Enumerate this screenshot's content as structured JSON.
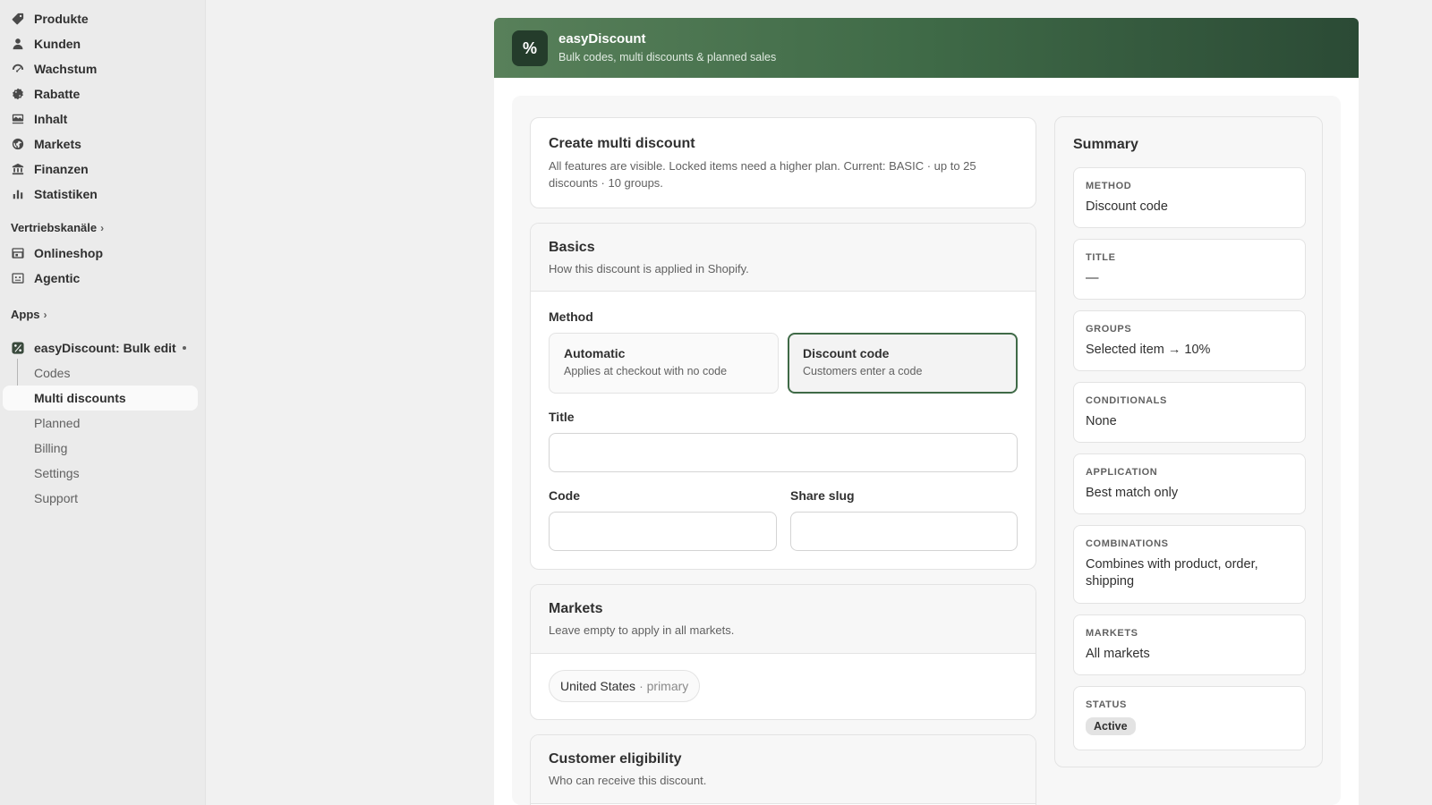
{
  "sidebar": {
    "nav": [
      {
        "label": "Produkte",
        "icon": "tag-icon"
      },
      {
        "label": "Kunden",
        "icon": "person-icon"
      },
      {
        "label": "Wachstum",
        "icon": "growth-icon"
      },
      {
        "label": "Rabatte",
        "icon": "discount-icon"
      },
      {
        "label": "Inhalt",
        "icon": "content-icon"
      },
      {
        "label": "Markets",
        "icon": "globe-icon"
      },
      {
        "label": "Finanzen",
        "icon": "bank-icon"
      },
      {
        "label": "Statistiken",
        "icon": "bar-chart-icon"
      }
    ],
    "sales_channels_label": "Vertriebskanäle",
    "channels": [
      {
        "label": "Onlineshop",
        "icon": "store-icon"
      },
      {
        "label": "Agentic",
        "icon": "agent-icon"
      }
    ],
    "apps_label": "Apps",
    "app": {
      "label": "easyDiscount: Bulk edit",
      "icon": "percent-icon"
    },
    "app_sub": [
      "Codes",
      "Multi discounts",
      "Planned",
      "Billing",
      "Settings",
      "Support"
    ],
    "active_sub": "Multi discounts"
  },
  "header": {
    "logo": "%",
    "title": "easyDiscount",
    "subtitle": "Bulk codes, multi discounts & planned sales",
    "gradient_start": "#58805a",
    "gradient_end": "#2b4a35"
  },
  "intro": {
    "title": "Create multi discount",
    "desc": "All features are visible. Locked items need a higher plan. Current: BASIC · up to 25 discounts · 10 groups."
  },
  "basics": {
    "title": "Basics",
    "desc": "How this discount is applied in Shopify.",
    "method_label": "Method",
    "options": [
      {
        "title": "Automatic",
        "desc": "Applies at checkout with no code",
        "selected": false
      },
      {
        "title": "Discount code",
        "desc": "Customers enter a code",
        "selected": true
      }
    ],
    "title_label": "Title",
    "title_value": "",
    "code_label": "Code",
    "code_value": "",
    "slug_label": "Share slug",
    "slug_value": ""
  },
  "markets": {
    "title": "Markets",
    "desc": "Leave empty to apply in all markets.",
    "chip_name": "United States",
    "chip_note": "· primary"
  },
  "eligibility": {
    "title": "Customer eligibility",
    "desc": "Who can receive this discount."
  },
  "summary": {
    "title": "Summary",
    "items": [
      {
        "key": "METHOD",
        "value": "Discount code"
      },
      {
        "key": "TITLE",
        "value": "—"
      },
      {
        "key": "GROUPS",
        "value": "Selected item → 10%"
      },
      {
        "key": "CONDITIONALS",
        "value": "None"
      },
      {
        "key": "APPLICATION",
        "value": "Best match only"
      },
      {
        "key": "COMBINATIONS",
        "value": "Combines with product, order, shipping"
      },
      {
        "key": "MARKETS",
        "value": "All markets"
      },
      {
        "key": "STATUS",
        "value": "Active"
      }
    ]
  },
  "colors": {
    "accent": "#3f6a47",
    "badge_bg": "#e3e3e3"
  }
}
